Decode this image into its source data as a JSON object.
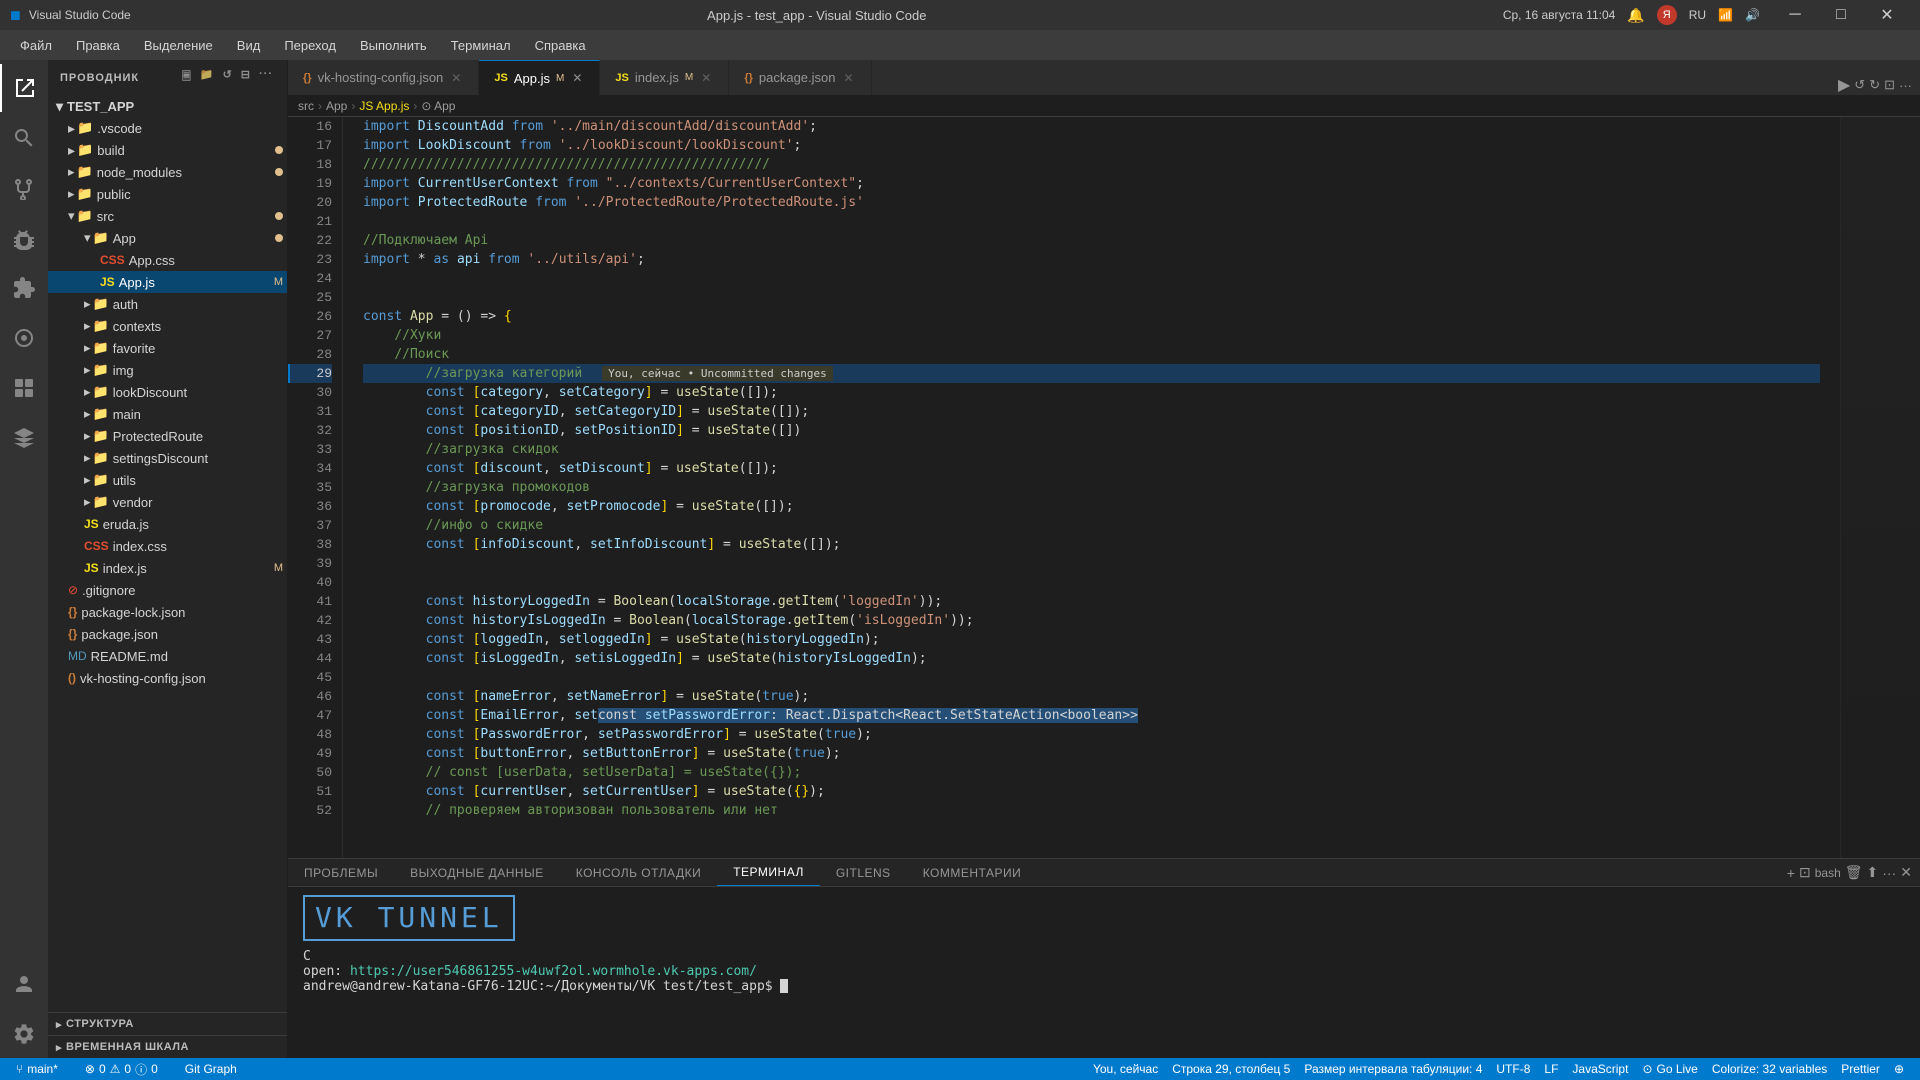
{
  "titleBar": {
    "icon": "●",
    "appName": "Visual Studio Code",
    "windowTitle": "App.js - test_app - Visual Studio Code",
    "datetime": "Ср, 16 августа  11:04",
    "notification": "🔔",
    "userInitial": "🅡",
    "lang": "RU",
    "wifi": "📶",
    "volume": "🔊",
    "minimizeBtn": "─",
    "restoreBtn": "□",
    "closeBtn": "✕"
  },
  "menuBar": {
    "items": [
      "Файл",
      "Правка",
      "Выделение",
      "Вид",
      "Переход",
      "Выполнить",
      "Терминал",
      "Справка"
    ]
  },
  "activityBar": {
    "icons": [
      {
        "name": "explorer-icon",
        "symbol": "⎘",
        "active": true
      },
      {
        "name": "search-icon",
        "symbol": "🔍",
        "active": false
      },
      {
        "name": "git-icon",
        "symbol": "⑂",
        "active": false
      },
      {
        "name": "debug-icon",
        "symbol": "▷",
        "active": false
      },
      {
        "name": "extensions-icon",
        "symbol": "⊞",
        "active": false
      },
      {
        "name": "remote-icon",
        "symbol": "⊙",
        "active": false
      },
      {
        "name": "unknown1-icon",
        "symbol": "⊕",
        "active": false
      },
      {
        "name": "unknown2-icon",
        "symbol": "⊗",
        "active": false
      }
    ],
    "bottomIcons": [
      {
        "name": "account-icon",
        "symbol": "👤"
      },
      {
        "name": "settings-icon",
        "symbol": "⚙"
      }
    ]
  },
  "sidebar": {
    "title": "ПРОВОДНИК",
    "rootName": "TEST_APP",
    "items": [
      {
        "id": "vscode",
        "label": ".vscode",
        "type": "folder",
        "indent": 1,
        "collapsed": true
      },
      {
        "id": "build",
        "label": "build",
        "type": "folder",
        "indent": 1,
        "collapsed": true,
        "dot": true
      },
      {
        "id": "node_modules",
        "label": "node_modules",
        "type": "folder",
        "indent": 1,
        "collapsed": true,
        "dot": true
      },
      {
        "id": "public",
        "label": "public",
        "type": "folder",
        "indent": 1,
        "collapsed": true
      },
      {
        "id": "src",
        "label": "src",
        "type": "folder",
        "indent": 1,
        "collapsed": false,
        "dot": true
      },
      {
        "id": "App",
        "label": "App",
        "type": "folder",
        "indent": 2,
        "collapsed": false,
        "dot": true
      },
      {
        "id": "App.css",
        "label": "App.css",
        "type": "css",
        "indent": 3,
        "dot": false
      },
      {
        "id": "App.js",
        "label": "App.js",
        "type": "js",
        "indent": 3,
        "dot": false,
        "selected": true,
        "badge": "M"
      },
      {
        "id": "auth",
        "label": "auth",
        "type": "folder",
        "indent": 2,
        "collapsed": true
      },
      {
        "id": "contexts",
        "label": "contexts",
        "type": "folder",
        "indent": 2,
        "collapsed": true
      },
      {
        "id": "favorite",
        "label": "favorite",
        "type": "folder",
        "indent": 2,
        "collapsed": true
      },
      {
        "id": "img",
        "label": "img",
        "type": "folder",
        "indent": 2,
        "collapsed": true
      },
      {
        "id": "lookDiscount",
        "label": "lookDiscount",
        "type": "folder",
        "indent": 2,
        "collapsed": true
      },
      {
        "id": "main",
        "label": "main",
        "type": "folder",
        "indent": 2,
        "collapsed": true
      },
      {
        "id": "ProtectedRoute",
        "label": "ProtectedRoute",
        "type": "folder",
        "indent": 2,
        "collapsed": true
      },
      {
        "id": "settingsDiscount",
        "label": "settingsDiscount",
        "type": "folder",
        "indent": 2,
        "collapsed": true
      },
      {
        "id": "utils",
        "label": "utils",
        "type": "folder",
        "indent": 2,
        "collapsed": true
      },
      {
        "id": "vendor",
        "label": "vendor",
        "type": "folder",
        "indent": 2,
        "collapsed": true
      },
      {
        "id": "eruda.js",
        "label": "eruda.js",
        "type": "js",
        "indent": 2
      },
      {
        "id": "index.css",
        "label": "index.css",
        "type": "css",
        "indent": 2
      },
      {
        "id": "index.js",
        "label": "index.js",
        "type": "js",
        "indent": 2,
        "badge": "M"
      },
      {
        "id": "gitignore",
        "label": ".gitignore",
        "type": "git",
        "indent": 1
      },
      {
        "id": "package-lock.json",
        "label": "package-lock.json",
        "type": "json",
        "indent": 1
      },
      {
        "id": "package.json",
        "label": "package.json",
        "type": "json",
        "indent": 1
      },
      {
        "id": "README.md",
        "label": "README.md",
        "type": "md",
        "indent": 1
      },
      {
        "id": "vk-hosting-config.json",
        "label": "vk-hosting-config.json",
        "type": "json",
        "indent": 1
      }
    ],
    "structureSection": "СТРУКТУРА",
    "timelineSection": "ВРЕМЕННАЯ ШКАЛА"
  },
  "tabs": [
    {
      "id": "vk-hosting",
      "label": "vk-hosting-config.json",
      "icon": "{}",
      "active": false,
      "modified": false
    },
    {
      "id": "App.js",
      "label": "App.js",
      "icon": "JS",
      "active": true,
      "modified": true
    },
    {
      "id": "index.js",
      "label": "index.js",
      "icon": "JS",
      "active": false,
      "modified": true
    },
    {
      "id": "package.json",
      "label": "package.json",
      "icon": "{}",
      "active": false,
      "modified": false
    }
  ],
  "breadcrumb": {
    "parts": [
      "src",
      "App",
      "JS App.js",
      "⊙ App"
    ]
  },
  "codeLines": [
    {
      "num": 16,
      "text": "import DiscountAdd from '../main/discountAdd/discountAdd';"
    },
    {
      "num": 17,
      "text": "import LookDiscount from '../lookDiscount/lookDiscount';"
    },
    {
      "num": 18,
      "text": "////////////////////////////////////////////////////"
    },
    {
      "num": 19,
      "text": "import CurrentUserContext from \"../contexts/CurrentUserContext\";"
    },
    {
      "num": 20,
      "text": "import ProtectedRoute from '../ProtectedRoute/ProtectedRoute.js'"
    },
    {
      "num": 21,
      "text": ""
    },
    {
      "num": 22,
      "text": "//Подключаем Api"
    },
    {
      "num": 23,
      "text": "import * as api from '../utils/api';"
    },
    {
      "num": 24,
      "text": ""
    },
    {
      "num": 25,
      "text": ""
    },
    {
      "num": 26,
      "text": "const App = () => {"
    },
    {
      "num": 27,
      "text": "    //Хуки"
    },
    {
      "num": 28,
      "text": "    //Поиск"
    },
    {
      "num": 29,
      "text": "        //загрузка категорий",
      "tooltip": "You, сейчас • Uncommitted changes"
    },
    {
      "num": 30,
      "text": "        const [category, setCategory] = useState([]);"
    },
    {
      "num": 31,
      "text": "        const [categoryID, setCategoryID] = useState([]);"
    },
    {
      "num": 32,
      "text": "        const [positionID, setPositionID] = useState([])"
    },
    {
      "num": 33,
      "text": "        //загрузка скидок"
    },
    {
      "num": 34,
      "text": "        const [discount, setDiscount] = useState([]);"
    },
    {
      "num": 35,
      "text": "        //загрузка промокодов"
    },
    {
      "num": 36,
      "text": "        const [promocode, setPromocode] = useState([]);"
    },
    {
      "num": 37,
      "text": "        //инфо о скидке"
    },
    {
      "num": 38,
      "text": "        const [infoDiscount, setInfoDiscount] = useState([]);"
    },
    {
      "num": 39,
      "text": ""
    },
    {
      "num": 40,
      "text": ""
    },
    {
      "num": 41,
      "text": "        const historyLoggedIn = Boolean(localStorage.getItem('loggedIn'));"
    },
    {
      "num": 42,
      "text": "        const historyIsLoggedIn = Boolean(localStorage.getItem('isLoggedIn'));"
    },
    {
      "num": 43,
      "text": "        const [loggedIn, setloggedIn] = useState(historyLoggedIn);"
    },
    {
      "num": 44,
      "text": "        const [isLoggedIn, setisLoggedIn] = useState(historyIsLoggedIn);"
    },
    {
      "num": 45,
      "text": ""
    },
    {
      "num": 46,
      "text": "        const [nameError, setNameError] = useState(true);"
    },
    {
      "num": 47,
      "text": "        const [EmailError, set"
    },
    {
      "num": 48,
      "text": "        const [PasswordError, setPasswordError] = useState(true);"
    },
    {
      "num": 49,
      "text": "        const [buttonError, setButtonError] = useState(true);"
    },
    {
      "num": 50,
      "text": "        // const [userData, setUserData] = useState({});"
    },
    {
      "num": 51,
      "text": "        const [currentUser, setCurrentUser] = useState({});"
    },
    {
      "num": 52,
      "text": "        // проверяем авторизован пользователь или нет"
    }
  ],
  "tooltip": {
    "text": "const setPasswordError: React.Dispatch<React.SetStateAction<boolean>>"
  },
  "panel": {
    "tabs": [
      "ПРОБЛЕМЫ",
      "ВЫХОДНЫЕ ДАННЫЕ",
      "КОНСОЛЬ ОТЛАДКИ",
      "ТЕРМИНАЛ",
      "GITLENS",
      "КОММЕНТАРИИ"
    ],
    "activeTab": "ТЕРМИНАЛ",
    "terminalContent": [
      {
        "text": "C"
      },
      {
        "text": "open:  https://user546861255-w4uwf2ol.wormhole.vk-apps.com/"
      },
      {
        "text": "andrew@andrew-Katana-GF76-12UC:~/Документы/VK test/test_app$"
      }
    ],
    "bash": "bash"
  },
  "statusBar": {
    "git": "⑂ main*",
    "errors": "⊗ 0",
    "warnings": "⚠ 0",
    "info": "ⓘ 0",
    "gitGraph": "Git Graph",
    "branch": "You, сейчас",
    "line": "Строка 29, столбец 5",
    "tabSize": "Размер интервала табуляции: 4",
    "encoding": "UTF-8",
    "lineEnding": "LF",
    "language": "JavaScript",
    "goLive": "Go Live",
    "colorize": "Colorize: 32 variables",
    "prettier": "Prettier",
    "liveShare": "⊕"
  },
  "vkAscii": "VK TUNNEL"
}
